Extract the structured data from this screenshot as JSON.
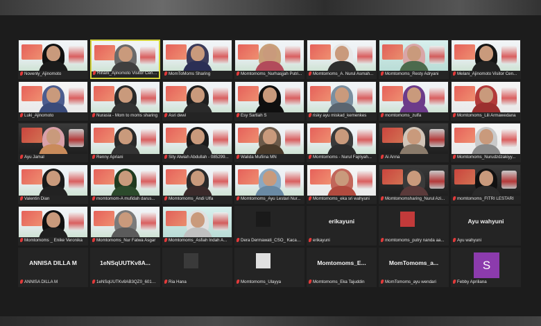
{
  "participants": [
    {
      "name": "Novenly_Ajinomoto",
      "kind": "video",
      "hijab": "#111111",
      "body": "#1b1b1b",
      "bg": "warm"
    },
    {
      "name": "Ririani_Ajinomoto Visitor Center",
      "kind": "video",
      "hijab": "#6a6a6a",
      "body": "#3f3f3f",
      "bg": "warm",
      "active": true
    },
    {
      "name": "MomToMoms Sharing",
      "kind": "video",
      "hijab": "#3b3b5a",
      "body": "#2b2f55",
      "bg": "warm"
    },
    {
      "name": "Momtomoms_Nurhasjjah Putri...",
      "kind": "video",
      "hijab": "#c9a07a",
      "body": "#b24b5b",
      "bg": "warm"
    },
    {
      "name": "Momtomoms_A. Nurul Asmah...",
      "kind": "video",
      "hijab": "#e8e8e8",
      "body": "#2e2e2e",
      "bg": "warm"
    },
    {
      "name": "Momtomoms_Resty Adryani",
      "kind": "video",
      "hijab": "#d9a6a8",
      "body": "#4c6a4d",
      "bg": "teal"
    },
    {
      "name": "Melani_Ajinomoto Visitor Cen...",
      "kind": "video",
      "hijab": "#151515",
      "body": "#222222",
      "bg": "warm"
    },
    {
      "name": "Luki_Ajinomoto",
      "kind": "video",
      "hijab": "#4c5d8f",
      "body": "#3a4b7a",
      "bg": "white"
    },
    {
      "name": "Nurasia - Mom to moms sharing",
      "kind": "video",
      "hijab": "#2a2a2a",
      "body": "#333333",
      "bg": "warm"
    },
    {
      "name": "Asri dewi",
      "kind": "video",
      "hijab": "#1f1f1f",
      "body": "#2a2a2a",
      "bg": "warm"
    },
    {
      "name": "Esy Sartiah S",
      "kind": "video",
      "hijab": "#0f0f0f",
      "body": "#0f0f0f",
      "bg": "warm"
    },
    {
      "name": "risky ayu miskad_kemenkes",
      "kind": "video",
      "hijab": "#7a8fa0",
      "body": "#5a6570",
      "bg": "warm"
    },
    {
      "name": "momtomoms_zulfa",
      "kind": "video",
      "hijab": "#6c3b8a",
      "body": "#6c3b8a",
      "bg": "warm"
    },
    {
      "name": "Momtomoms_Lili Armawedana",
      "kind": "video",
      "hijab": "#b23a3a",
      "body": "#9b2f2f",
      "bg": "white"
    },
    {
      "name": "Ayu Jamal",
      "kind": "video",
      "hijab": "#d9a0a8",
      "body": "#c98b5b",
      "bg": "dark"
    },
    {
      "name": "Renny Apriani",
      "kind": "video",
      "hijab": "#2a2a2a",
      "body": "#333333",
      "bg": "warm"
    },
    {
      "name": "Sity Alwiah Abdullah - 085299...",
      "kind": "video",
      "hijab": "#1a1a1a",
      "body": "#2a2a2a",
      "bg": "warm"
    },
    {
      "name": "Walida Mufiina MN",
      "kind": "video",
      "hijab": "#6b5a4a",
      "body": "#4a3b2b",
      "bg": "warm"
    },
    {
      "name": "Momtomoms - Nurul Fajriyah...",
      "kind": "video",
      "hijab": "#3a3a3a",
      "body": "#2d2d2d",
      "bg": "warm"
    },
    {
      "name": "Ai Anna",
      "kind": "video",
      "hijab": "#d2c5b8",
      "body": "#8a7b6b",
      "bg": "dark"
    },
    {
      "name": "Momtomoms_Nurudzdzakiyy...",
      "kind": "video",
      "hijab": "#c9c9c9",
      "body": "#8a8a8a",
      "bg": "white"
    },
    {
      "name": "Valentin Dian",
      "kind": "video",
      "hijab": "#1a1a1a",
      "body": "#222222",
      "bg": "warm"
    },
    {
      "name": "momtomom-A mufidah darus...",
      "kind": "video",
      "hijab": "#1f3a1f",
      "body": "#2c4a2c",
      "bg": "warm"
    },
    {
      "name": "Momtomoms_Andi Ulfa",
      "kind": "video",
      "hijab": "#2a2a2a",
      "body": "#3a2a2a",
      "bg": "warm"
    },
    {
      "name": "Momtomoms_Ayu Lestari Nur...",
      "kind": "video",
      "hijab": "#8aa8c2",
      "body": "#6a8aa4",
      "bg": "warm"
    },
    {
      "name": "Momtomoms_eka sri wahyuni",
      "kind": "video",
      "hijab": "#c2665a",
      "body": "#b24b3f",
      "bg": "white"
    },
    {
      "name": "Momtomomsharing_Nurul Azi...",
      "kind": "video",
      "hijab": "#3a3a3a",
      "body": "#5a3a3a",
      "bg": "dark"
    },
    {
      "name": "momtomoms_FITRI LESTARI",
      "kind": "video",
      "hijab": "#111111",
      "body": "#2a2a2a",
      "bg": "dark"
    },
    {
      "name": "Momtomoms _ Enike Veronika",
      "kind": "video",
      "hijab": "#111111",
      "body": "#1f1f1f",
      "bg": "warm"
    },
    {
      "name": "Momtomoms_Nur Fatwa Asgar",
      "kind": "video",
      "hijab": "#7b7b7b",
      "body": "#5b5b5b",
      "bg": "warm"
    },
    {
      "name": "Momtomoms_Asfiah Indah A...",
      "kind": "video",
      "hijab": "#e0e0e0",
      "body": "#c0c0c0",
      "bg": "teal"
    },
    {
      "name": "Dera Dermawati_CSO_ Kacab ...",
      "kind": "small",
      "hijab": "#1a1a1a",
      "body": "#d9c9b0",
      "bg": "white"
    },
    {
      "name": "erikayuni",
      "kind": "text",
      "display": "erikayuni"
    },
    {
      "name": "momtomoms_putry nanda aa...",
      "kind": "small",
      "hijab": "#c23a3a",
      "body": "#a82e2e",
      "bg": "teal"
    },
    {
      "name": "Ayu wahyuni",
      "kind": "text",
      "display": "Ayu wahyuni"
    },
    {
      "name": "ANNISA DILLA M",
      "kind": "text",
      "display": "ANNISA DILLA M"
    },
    {
      "name": "1eNSqUUTKv8AB3QZ0_601Sw...",
      "kind": "text",
      "display": "1eNSqUUTKv8A..."
    },
    {
      "name": "Ria Hana",
      "kind": "small",
      "hijab": "#3a3a3a",
      "body": "#5a4a3a",
      "bg": "warm"
    },
    {
      "name": "Momtomoms_Ulayya",
      "kind": "small",
      "hijab": "#e0e0e0",
      "body": "#c0c0c0",
      "bg": "warm"
    },
    {
      "name": "Momtomoms_Eka Tajuddin",
      "kind": "text",
      "display": "Momtomoms_E..."
    },
    {
      "name": "MomTomoms_ayu wendari",
      "kind": "text",
      "display": "MomTomoms_a..."
    },
    {
      "name": "Febby Apriliana",
      "kind": "avatar",
      "display": "S"
    }
  ]
}
